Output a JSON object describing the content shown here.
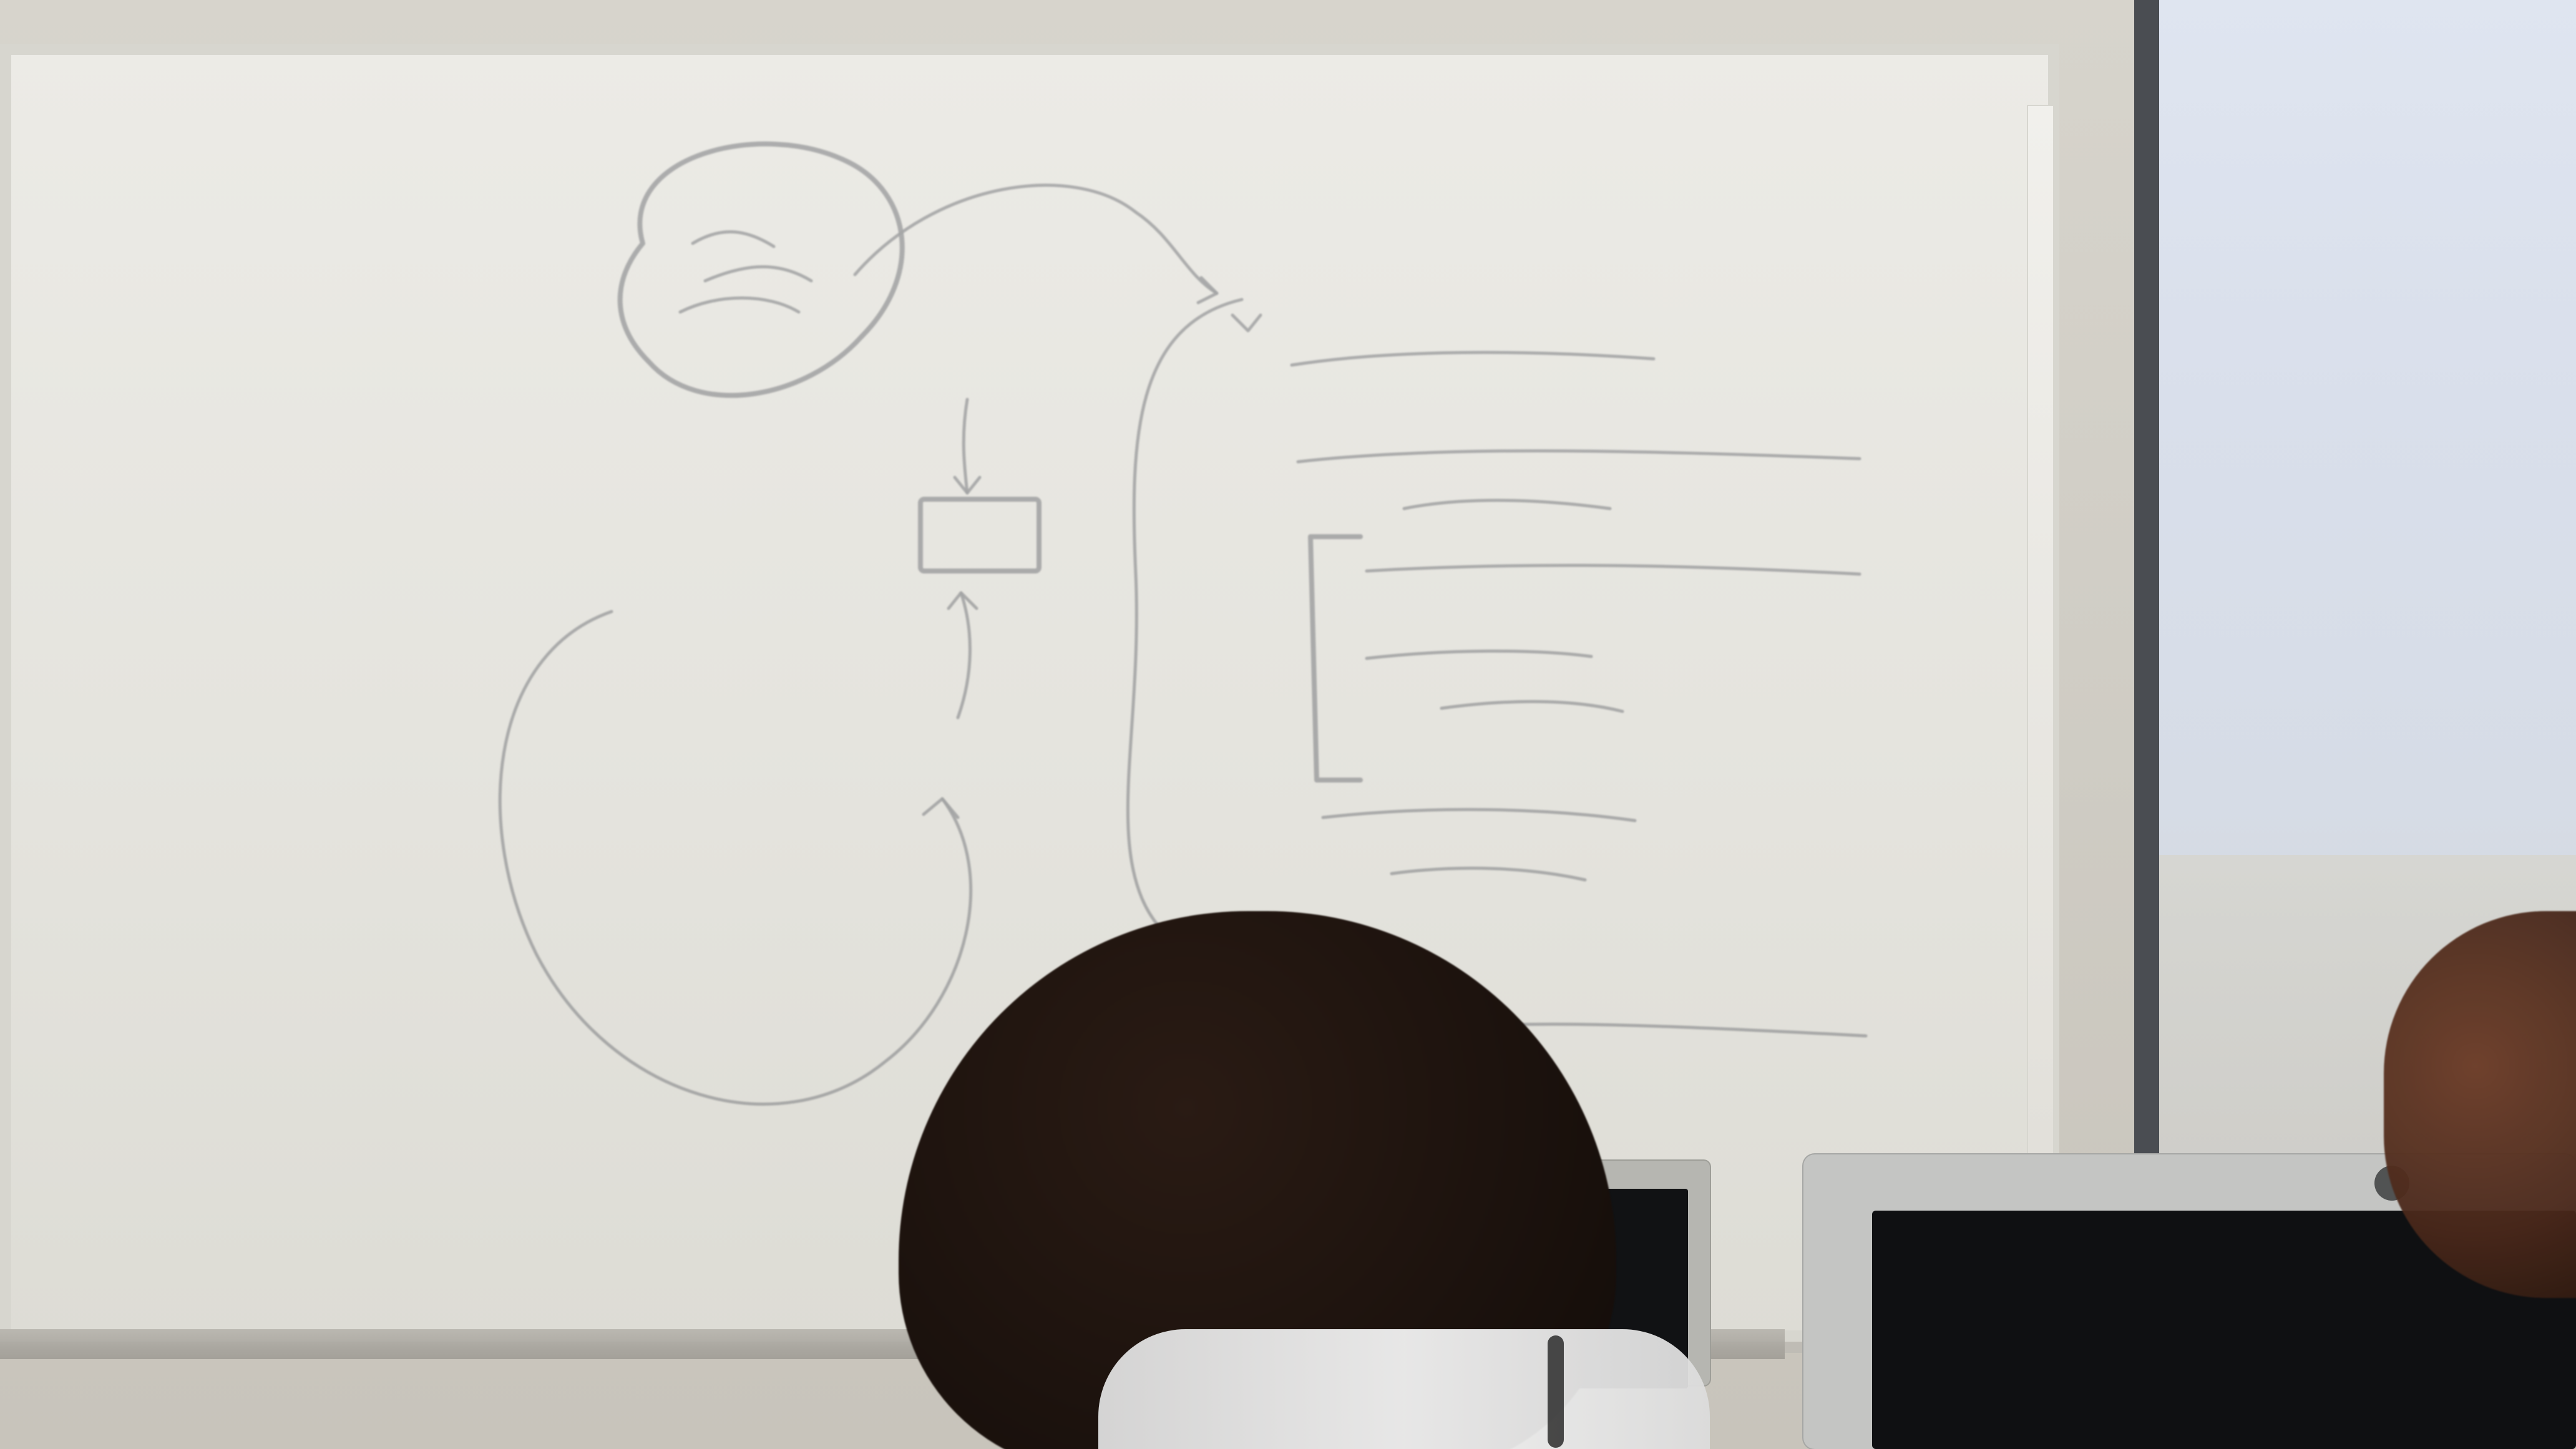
{
  "scene": {
    "colors": {
      "whiteboard": "#E6E5DF",
      "wall": "#D0CDC5",
      "projector_screen": "#DCE2ED",
      "monitor_bezel": "#C4C5C3",
      "monitor_screen": "#0F1012",
      "hair_dark": "#1D130E",
      "hair_brown": "#4C2A1C",
      "marker": "#6D6F74"
    },
    "icons": {
      "monitor_logo": "hp-logo-icon"
    }
  }
}
